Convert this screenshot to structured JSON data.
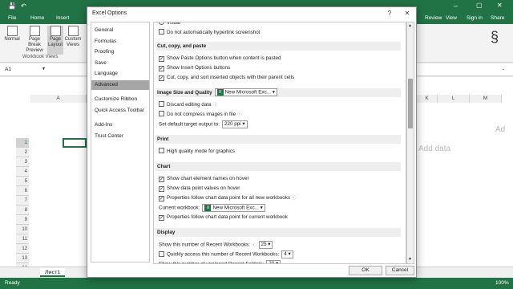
{
  "window_title": "Excel Options",
  "excel": {
    "menu": [
      "File",
      "Home",
      "Insert",
      "Review",
      "View",
      "Sign in",
      "Share"
    ],
    "ribbon_buttons": [
      "Normal",
      "Page Break Preview",
      "Page Layout",
      "Custom Views"
    ],
    "ribbon_group": "Workbook Views",
    "name_box": "A1",
    "columns_left": [
      "A"
    ],
    "columns_right": [
      "J",
      "K",
      "L",
      "M"
    ],
    "rows": [
      "1",
      "2",
      "3",
      "4",
      "5",
      "6",
      "7",
      "8",
      "9",
      "10",
      "11",
      "12",
      "13",
      "14"
    ],
    "sheet_tab": "Лист1",
    "status_left": "Ready",
    "zoom": "100%",
    "bg_text_1": "Add data",
    "bg_text_2": "Ad"
  },
  "sidebar": {
    "items": [
      "General",
      "Formulas",
      "Proofing",
      "Save",
      "Language",
      "Advanced",
      "Customize Ribbon",
      "Quick Access Toolbar",
      "Add-Ins",
      "Trust Center"
    ],
    "selected": "Advanced"
  },
  "content": {
    "top_rows": [
      {
        "label": "Visual",
        "checked": false,
        "radio": true
      },
      {
        "label": "Do not automatically hyperlink screenshot",
        "checked": false
      }
    ],
    "sections": [
      {
        "title": "Cut, copy, and paste",
        "rows": [
          {
            "label": "Show Paste Options button when content is pasted",
            "checked": true
          },
          {
            "label": "Show Insert Options buttons",
            "checked": true
          },
          {
            "label": "Cut, copy, and sort inserted objects with their parent cells",
            "checked": true
          }
        ]
      },
      {
        "title": "Image Size and Quality",
        "dropdown": "New Microsoft Exc...",
        "rows": [
          {
            "label": "Discard editing data",
            "checked": false,
            "info": true
          },
          {
            "label": "Do not compress images in file",
            "checked": false,
            "info": true
          },
          {
            "label": "Set default target output to:",
            "checked": null,
            "dropdown": "220 ppi"
          }
        ]
      },
      {
        "title": "Print",
        "rows": [
          {
            "label": "High quality mode for graphics",
            "checked": false
          }
        ]
      },
      {
        "title": "Chart",
        "rows": [
          {
            "label": "Show chart element names on hover",
            "checked": true
          },
          {
            "label": "Show data point values on hover",
            "checked": true
          },
          {
            "label": "Properties follow chart data point for all new workbooks",
            "checked": true,
            "info": true
          },
          {
            "label": "Current workbook:",
            "checked": null,
            "dropdown": "New Microsoft Exc..."
          },
          {
            "label": "Properties follow chart data point for current workbook",
            "checked": true
          }
        ]
      },
      {
        "title": "Display",
        "rows": [
          {
            "label": "Show this number of Recent Workbooks:",
            "checked": null,
            "dropdown": "25",
            "info": true
          },
          {
            "label": "Quickly access this number of Recent Workbooks:",
            "checked": false,
            "dropdown": "4"
          },
          {
            "label": "Show this number of unpinned Recent Folders:",
            "checked": null,
            "dropdown": "20"
          }
        ]
      }
    ]
  },
  "buttons": {
    "ok": "OK",
    "cancel": "Cancel"
  },
  "controls": {
    "help": "?",
    "close": "✕"
  },
  "colors": {
    "excel_green": "#217346",
    "selected_item": "#a6a6a6"
  }
}
